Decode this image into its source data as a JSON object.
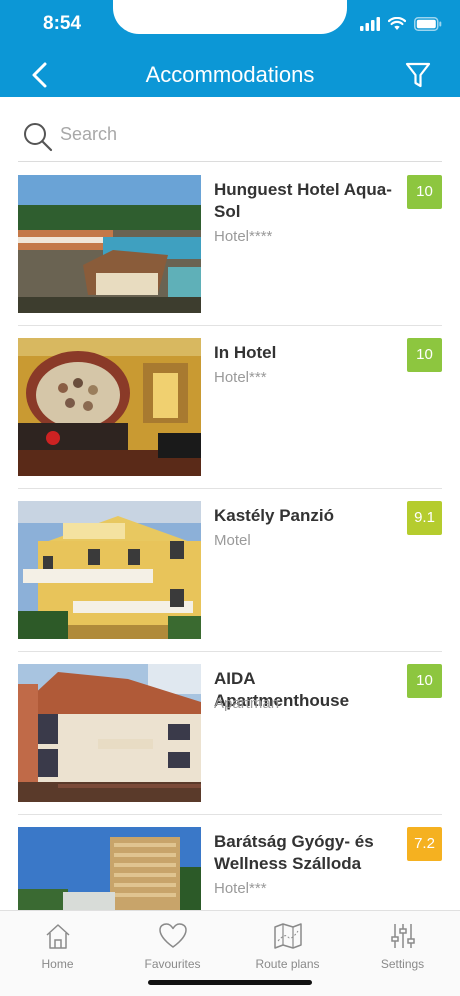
{
  "status_bar": {
    "time": "8:54"
  },
  "header": {
    "title": "Accommodations"
  },
  "search": {
    "placeholder": "Search"
  },
  "accommodations": [
    {
      "name": "Hunguest Hotel Aqua-Sol",
      "type": "Hotel****",
      "rating": "10",
      "rating_color": "#8dc63f"
    },
    {
      "name": "In Hotel",
      "type": "Hotel***",
      "rating": "10",
      "rating_color": "#8dc63f"
    },
    {
      "name": "Kastély Panzió",
      "type": "Motel",
      "rating": "9.1",
      "rating_color": "#b5cc2e"
    },
    {
      "name": "AIDA Apartmenthouse",
      "type": "Apartman",
      "rating": "10",
      "rating_color": "#8dc63f"
    },
    {
      "name": "Barátság Gyógy- és Wellness Szálloda",
      "type": "Hotel***",
      "rating": "7.2",
      "rating_color": "#f5b120"
    }
  ],
  "tabbar": {
    "tabs": [
      {
        "label": "Home",
        "icon": "home-icon"
      },
      {
        "label": "Favourites",
        "icon": "heart-icon"
      },
      {
        "label": "Route plans",
        "icon": "map-icon"
      },
      {
        "label": "Settings",
        "icon": "sliders-icon"
      }
    ]
  }
}
